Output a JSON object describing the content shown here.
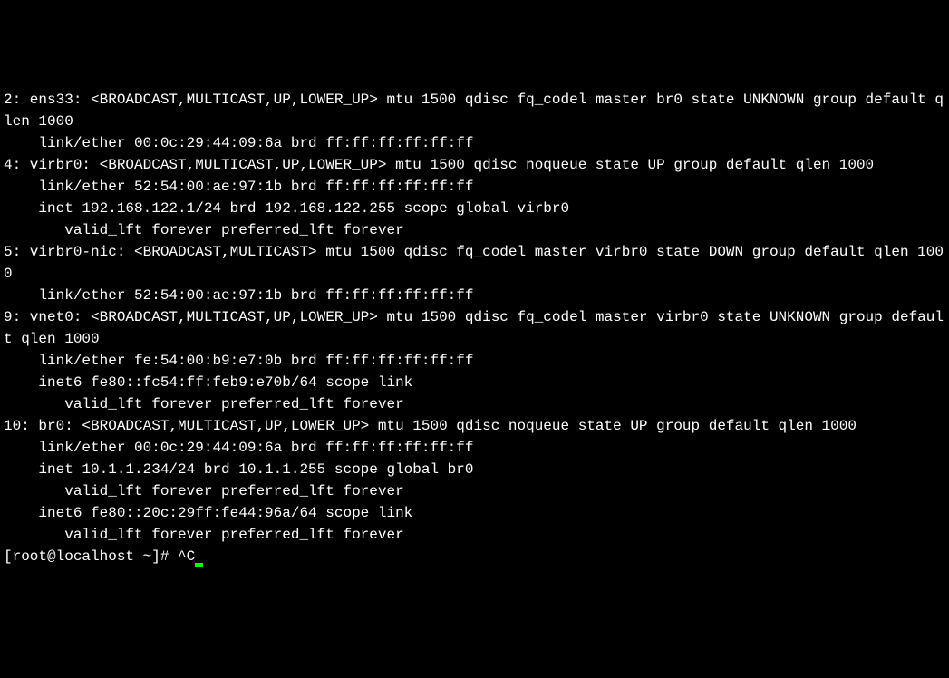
{
  "lines": {
    "l0": "2: ens33: <BROADCAST,MULTICAST,UP,LOWER_UP> mtu 1500 qdisc fq_codel master br0 state UNKNOWN group default qlen 1000",
    "l1": "    link/ether 00:0c:29:44:09:6a brd ff:ff:ff:ff:ff:ff",
    "l2": "4: virbr0: <BROADCAST,MULTICAST,UP,LOWER_UP> mtu 1500 qdisc noqueue state UP group default qlen 1000",
    "l3": "    link/ether 52:54:00:ae:97:1b brd ff:ff:ff:ff:ff:ff",
    "l4": "    inet 192.168.122.1/24 brd 192.168.122.255 scope global virbr0",
    "l5": "       valid_lft forever preferred_lft forever",
    "l6": "5: virbr0-nic: <BROADCAST,MULTICAST> mtu 1500 qdisc fq_codel master virbr0 state DOWN group default qlen 1000",
    "l7": "    link/ether 52:54:00:ae:97:1b brd ff:ff:ff:ff:ff:ff",
    "l8": "9: vnet0: <BROADCAST,MULTICAST,UP,LOWER_UP> mtu 1500 qdisc fq_codel master virbr0 state UNKNOWN group default qlen 1000",
    "l9": "    link/ether fe:54:00:b9:e7:0b brd ff:ff:ff:ff:ff:ff",
    "l10": "    inet6 fe80::fc54:ff:feb9:e70b/64 scope link",
    "l11": "       valid_lft forever preferred_lft forever",
    "l12": "10: br0: <BROADCAST,MULTICAST,UP,LOWER_UP> mtu 1500 qdisc noqueue state UP group default qlen 1000",
    "l13": "    link/ether 00:0c:29:44:09:6a brd ff:ff:ff:ff:ff:ff",
    "l14": "    inet 10.1.1.234/24 brd 10.1.1.255 scope global br0",
    "l15": "       valid_lft forever preferred_lft forever",
    "l16": "    inet6 fe80::20c:29ff:fe44:96a/64 scope link",
    "l17": "       valid_lft forever preferred_lft forever",
    "prompt": "[root@localhost ~]# ^C"
  }
}
